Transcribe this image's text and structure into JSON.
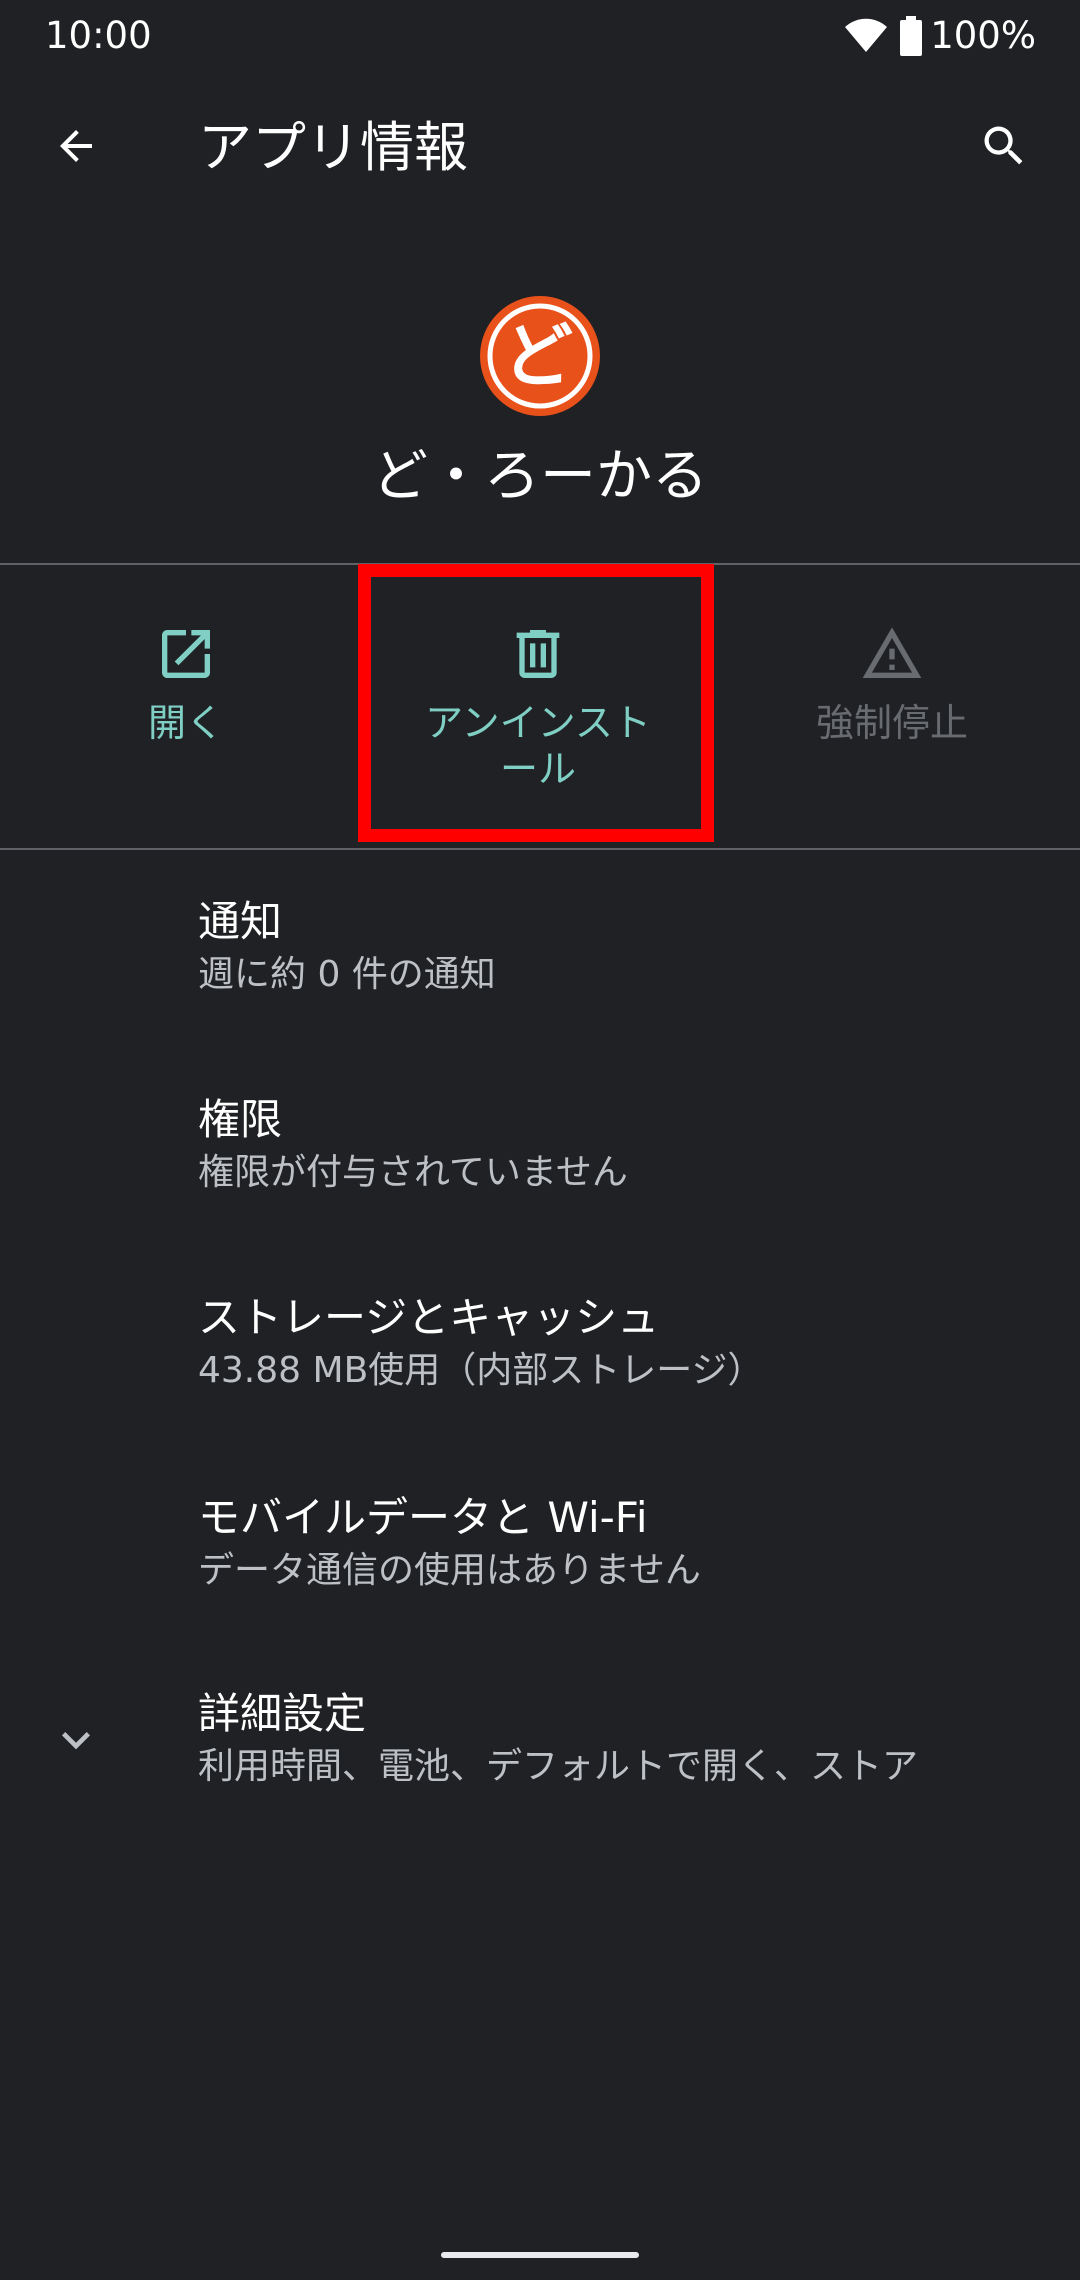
{
  "status_bar": {
    "time": "10:00",
    "battery": "100%",
    "icons": [
      "wifi-icon",
      "battery-icon"
    ]
  },
  "app_bar": {
    "title": "アプリ情報",
    "back_icon": "arrow-back-icon",
    "search_icon": "search-icon"
  },
  "app": {
    "name": "ど・ろーかる",
    "icon_glyph": "ど",
    "icon_color": "#e8511a"
  },
  "actions": [
    {
      "label": "開く",
      "icon": "open-in-new-icon",
      "enabled": true
    },
    {
      "label": "アンインストール",
      "icon": "delete-icon",
      "enabled": true
    },
    {
      "label": "強制停止",
      "icon": "warning-icon",
      "enabled": false
    }
  ],
  "settings": [
    {
      "title": "通知",
      "summary": "週に約 0 件の通知"
    },
    {
      "title": "権限",
      "summary": "権限が付与されていません"
    },
    {
      "title": "ストレージとキャッシュ",
      "summary": "43.88 MB使用（内部ストレージ）"
    },
    {
      "title": "モバイルデータと Wi-Fi",
      "summary": "データ通信の使用はありません"
    },
    {
      "title": "詳細設定",
      "summary": "利用時間、電池、デフォルトで開く、ストア",
      "icon": "chevron-down-icon"
    }
  ],
  "colors": {
    "background": "#202124",
    "accent": "#7fcfc4",
    "disabled": "#686b70",
    "highlight": "#ff0000",
    "secondary_text": "#bdc1c6"
  }
}
